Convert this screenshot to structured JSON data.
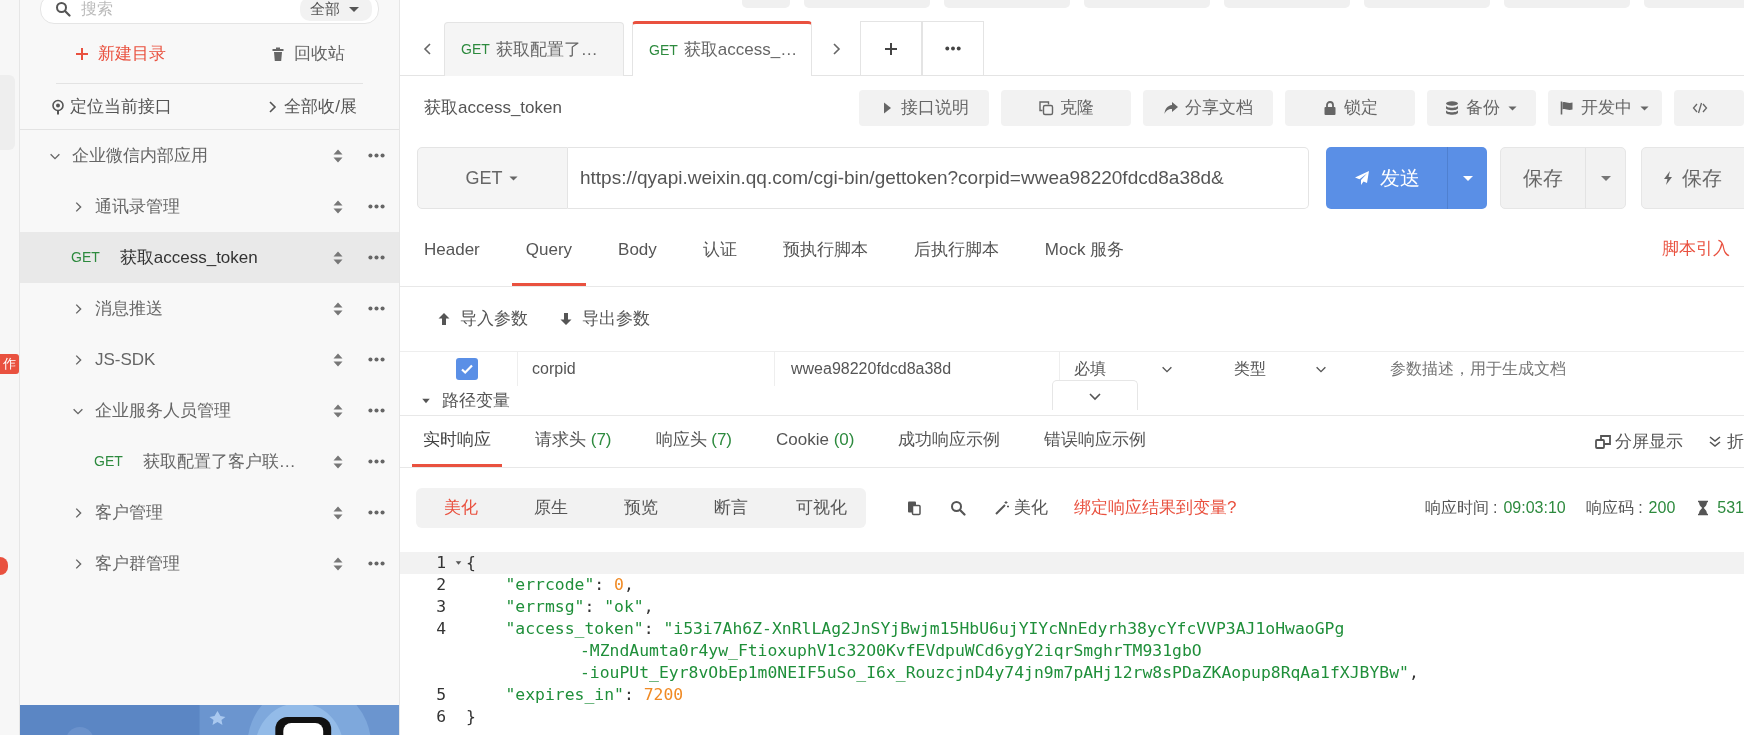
{
  "left_rail": {
    "badge": "作"
  },
  "sidebar": {
    "search": {
      "placeholder": "搜索",
      "scope": "全部"
    },
    "actions": [
      {
        "kind": "new",
        "label": "新建目录"
      },
      {
        "kind": "trash",
        "label": "回收站"
      }
    ],
    "locate": "定位当前接口",
    "toggle_all": "全部收/展",
    "tree": [
      {
        "kind": "folder",
        "label": "企业微信内部应用",
        "expanded": true,
        "selected": false,
        "children": [
          {
            "kind": "folder",
            "label": "通讯录管理",
            "expanded": false,
            "selected": false
          },
          {
            "kind": "api",
            "method": "GET",
            "label": "获取access_token",
            "selected": true
          },
          {
            "kind": "folder",
            "label": "消息推送",
            "expanded": false,
            "selected": false
          },
          {
            "kind": "folder",
            "label": "JS-SDK",
            "expanded": false,
            "selected": false
          },
          {
            "kind": "folder",
            "label": "企业服务人员管理",
            "expanded": true,
            "selected": false,
            "children": [
              {
                "kind": "api",
                "method": "GET",
                "label": "获取配置了客户联…",
                "selected": false
              }
            ]
          },
          {
            "kind": "folder",
            "label": "客户管理",
            "expanded": false,
            "selected": false
          },
          {
            "kind": "folder",
            "label": "客户群管理",
            "expanded": false,
            "selected": false
          }
        ]
      }
    ]
  },
  "open_tabs": [
    {
      "method": "GET",
      "label": "获取配置了…",
      "selected": false
    },
    {
      "method": "GET",
      "label": "获取access_…",
      "selected": true
    }
  ],
  "api": {
    "title": "获取access_token",
    "buttons": [
      {
        "kind": "doc",
        "label": "接口说明"
      },
      {
        "kind": "clone",
        "label": "克隆"
      },
      {
        "kind": "share",
        "label": "分享文档"
      },
      {
        "kind": "lock",
        "label": "锁定"
      },
      {
        "kind": "backup",
        "label": "备份"
      },
      {
        "kind": "status",
        "label": "开发中"
      },
      {
        "kind": "code"
      }
    ]
  },
  "request": {
    "method": "GET",
    "url": "https://qyapi.weixin.qq.com/cgi-bin/gettoken?corpid=wwea98220fdcd8a38d&",
    "send": "发送",
    "save": "保存",
    "save_run": "保存"
  },
  "param_tabs": [
    {
      "label": "Header",
      "selected": false
    },
    {
      "label": "Query",
      "selected": true
    },
    {
      "label": "Body",
      "selected": false
    },
    {
      "label": "认证",
      "selected": false
    },
    {
      "label": "预执行脚本",
      "selected": false
    },
    {
      "label": "后执行脚本",
      "selected": false
    },
    {
      "label": "Mock 服务",
      "selected": false
    }
  ],
  "script_link": "脚本引入",
  "param_actions": [
    {
      "kind": "import",
      "label": "导入参数"
    },
    {
      "kind": "export",
      "label": "导出参数"
    }
  ],
  "params": [
    {
      "checked": true,
      "name": "corpid",
      "value": "wwea98220fdcd8a38d",
      "required": "必填",
      "type": "类型",
      "description_placeholder": "参数描述，用于生成文档"
    }
  ],
  "path_vars": {
    "label": "路径变量"
  },
  "response_tabs": [
    {
      "label": "实时响应",
      "selected": true
    },
    {
      "label": "请求头",
      "count": "(7)",
      "selected": false
    },
    {
      "label": "响应头",
      "count": "(7)",
      "selected": false
    },
    {
      "label": "Cookie",
      "count": "(0)",
      "selected": false
    },
    {
      "label": "成功响应示例",
      "selected": false
    },
    {
      "label": "错误响应示例",
      "selected": false
    }
  ],
  "response_actions": [
    {
      "kind": "split",
      "label": "分屏显示"
    },
    {
      "kind": "collapse",
      "label": "折"
    }
  ],
  "view_modes": [
    {
      "label": "美化",
      "selected": true
    },
    {
      "label": "原生",
      "selected": false
    },
    {
      "label": "预览",
      "selected": false
    },
    {
      "label": "断言",
      "selected": false
    },
    {
      "label": "可视化",
      "selected": false
    }
  ],
  "beautify": "美化",
  "bind_link": "绑定响应结果到变量?",
  "stats": [
    {
      "kind": "time",
      "label": "响应时间 :",
      "value": "09:03:10"
    },
    {
      "kind": "code",
      "label": "响应码 :",
      "value": "200"
    },
    {
      "kind": "duration",
      "value": "531"
    }
  ],
  "code_lines": [
    {
      "number": "1",
      "fold": true,
      "tokens": [
        {
          "kind": "punct",
          "text": "{"
        }
      ]
    },
    {
      "number": "2",
      "tokens": [
        {
          "kind": "key",
          "text": "\"errcode\""
        },
        {
          "kind": "punct",
          "text": ": "
        },
        {
          "kind": "number",
          "text": "0"
        },
        {
          "kind": "punct",
          "text": ","
        }
      ]
    },
    {
      "number": "3",
      "tokens": [
        {
          "kind": "key",
          "text": "\"errmsg\""
        },
        {
          "kind": "punct",
          "text": ": "
        },
        {
          "kind": "string",
          "text": "\"ok\""
        },
        {
          "kind": "punct",
          "text": ","
        }
      ]
    },
    {
      "number": "4",
      "tokens": [
        {
          "kind": "key",
          "text": "\"access_token\""
        },
        {
          "kind": "punct",
          "text": ": "
        },
        {
          "kind": "string",
          "text": "\"i53i7Ah6Z-XnRlLAg2JnSYjBwjm15HbU6ujYIYcNnEdyrh38ycYfcVVP3AJ1oHwaoGPg"
        }
      ],
      "wraps": [
        [
          {
            "kind": "string",
            "text": "-MZndAumta0r4yw_FtioxuphV1c32O0KvfEVdpuWCd6ygY2iqrSmghrTM931gbO"
          }
        ],
        [
          {
            "kind": "string",
            "text": "-iouPUt_Eyr8vObEp1m0NEIF5uSo_I6x_RouzcjnD4y74jn9m7pAHj12rw8sPDaZKAopup8RqAa1fXJBYBw\""
          },
          {
            "kind": "punct",
            "text": ","
          }
        ]
      ]
    },
    {
      "number": "5",
      "tokens": [
        {
          "kind": "key",
          "text": "\"expires_in\""
        },
        {
          "kind": "punct",
          "text": ": "
        },
        {
          "kind": "number",
          "text": "7200"
        }
      ]
    },
    {
      "number": "6",
      "tokens": [
        {
          "kind": "punct",
          "text": "}"
        }
      ]
    }
  ]
}
